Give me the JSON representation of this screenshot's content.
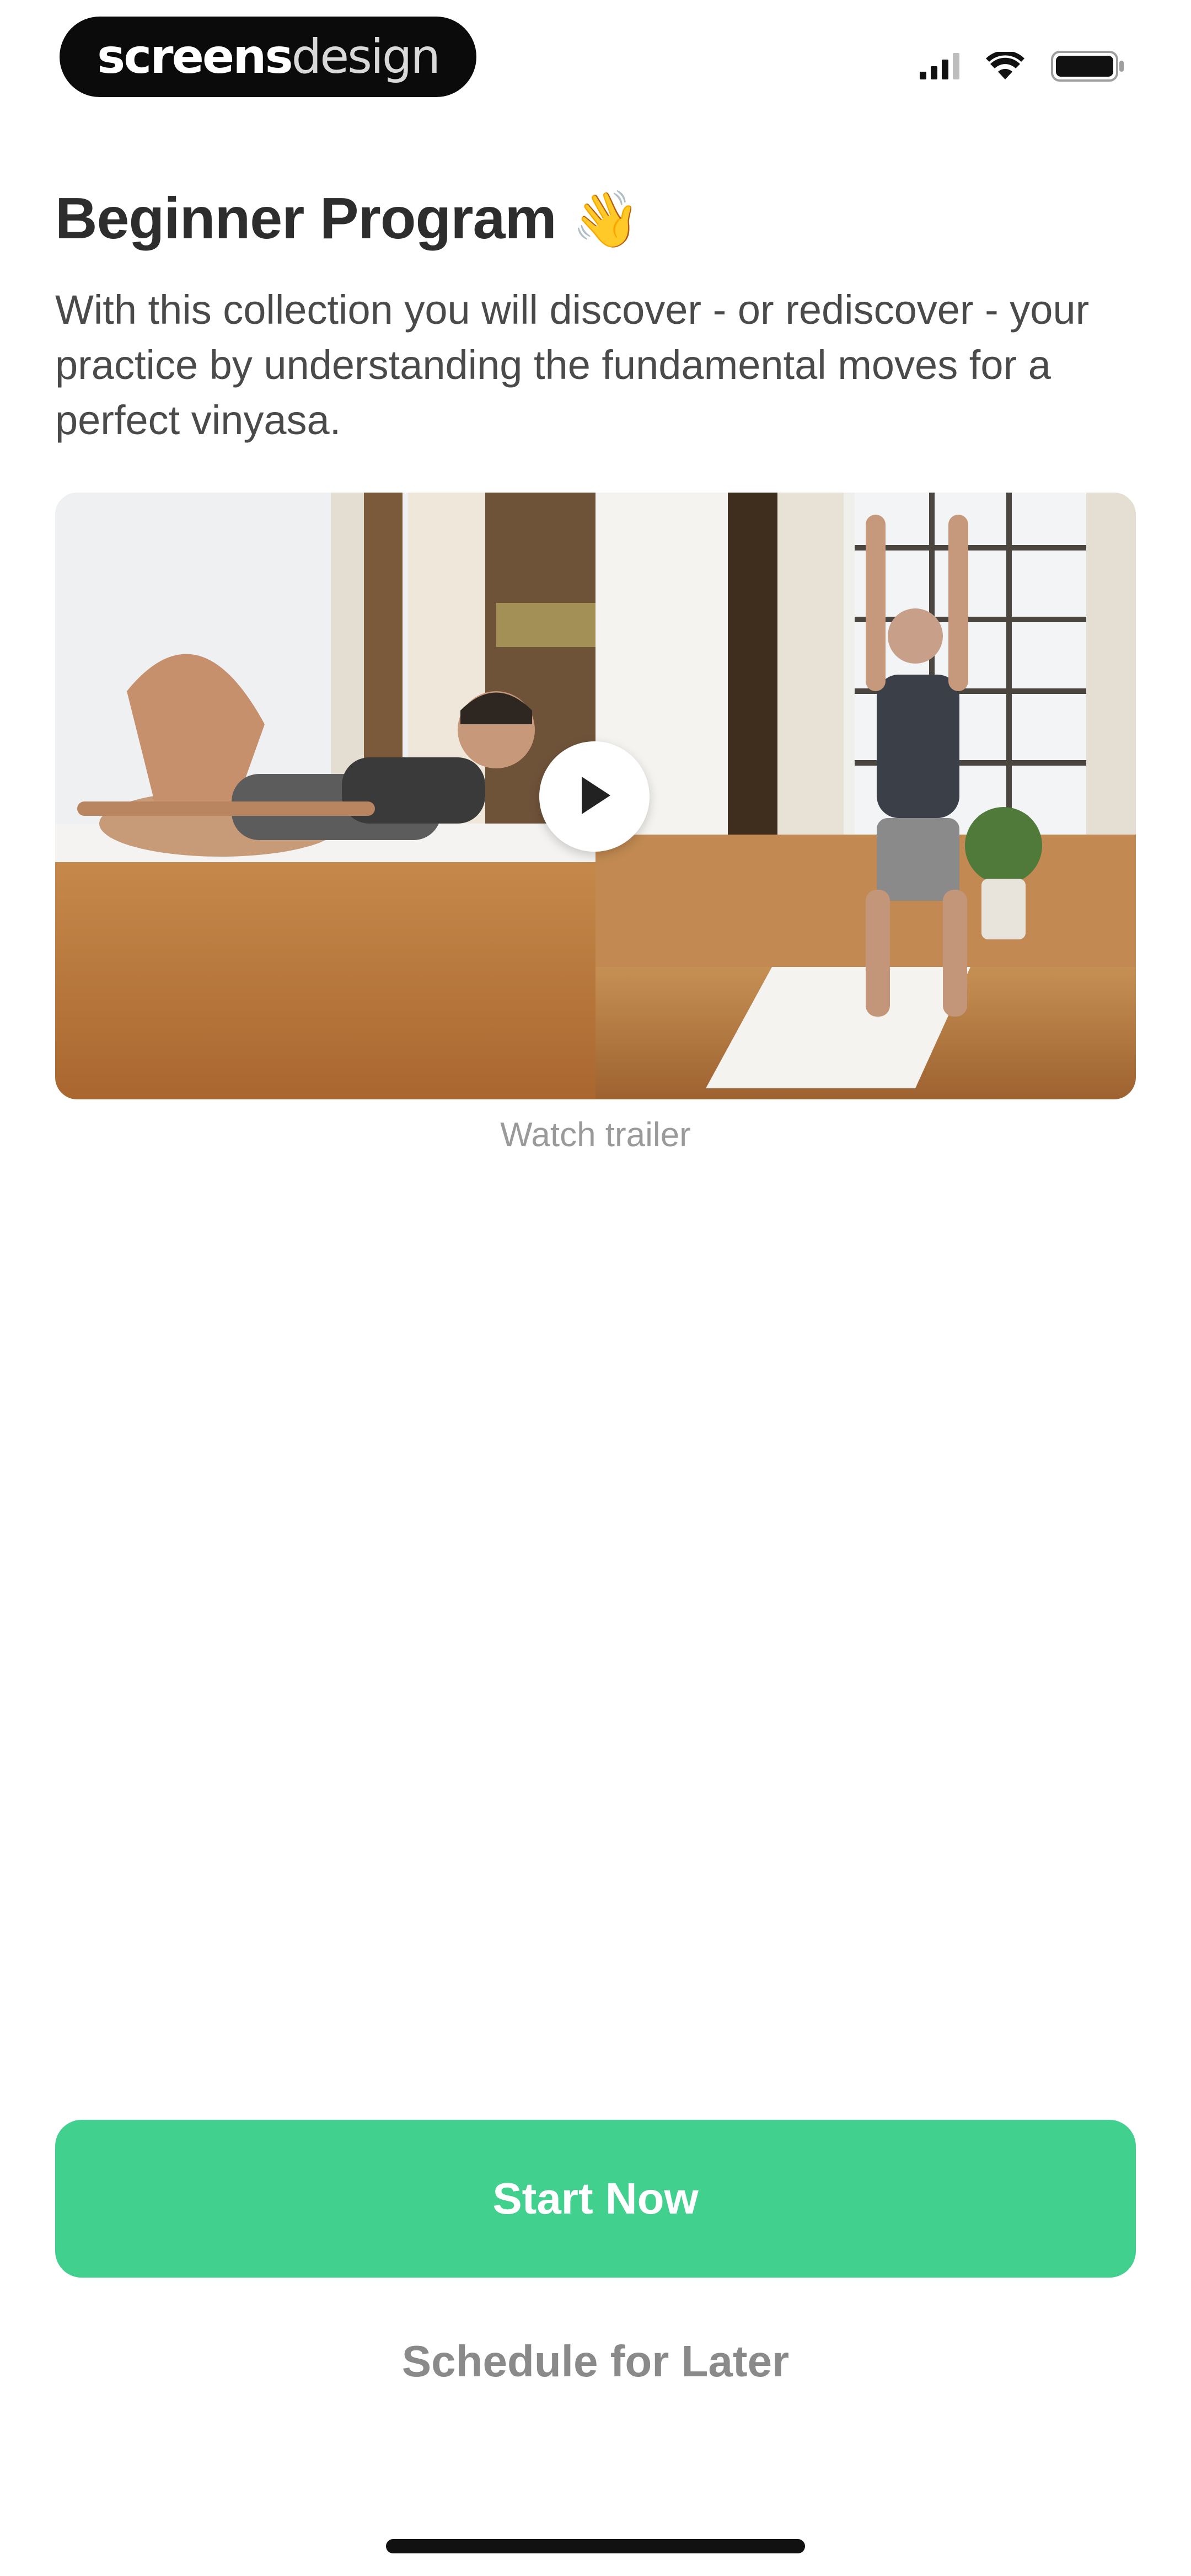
{
  "status_bar": {
    "brand_bold": "screens",
    "brand_light": "design",
    "icons": [
      "signal-icon",
      "wifi-icon",
      "battery-icon"
    ]
  },
  "program": {
    "title": "Beginner Program",
    "title_emoji": "👋",
    "description": "With this collection you will discover - or rediscover - your practice by understanding the fundamental moves for a perfect vinyasa."
  },
  "media": {
    "play_icon": "play-icon",
    "caption": "Watch trailer"
  },
  "actions": {
    "start_label": "Start Now",
    "schedule_label": "Schedule for Later"
  },
  "colors": {
    "accent": "#42d08e",
    "title": "#2d2d2d",
    "muted": "#9a9a9a"
  }
}
